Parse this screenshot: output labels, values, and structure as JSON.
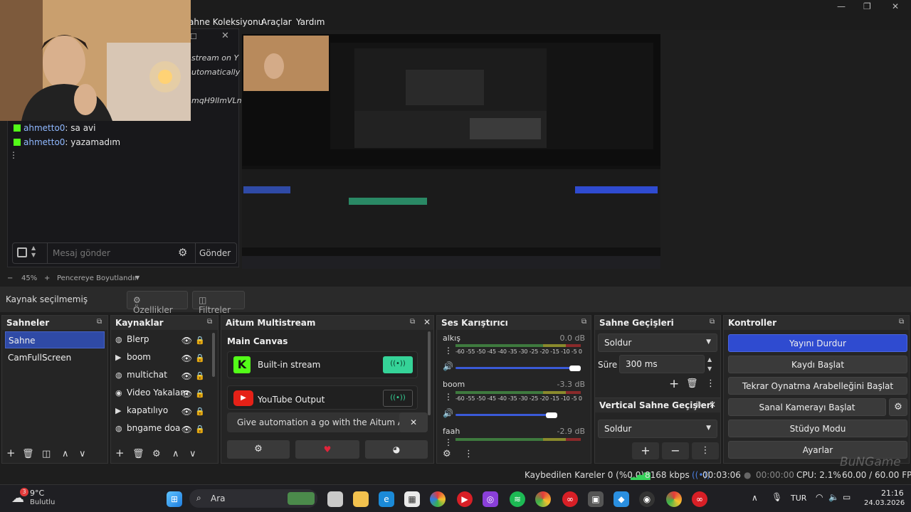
{
  "menu": {
    "items": [
      "ahne Koleksiyonu",
      "Araçlar",
      "Yardım"
    ]
  },
  "chat": {
    "ghost_lines": [
      "stream on Y",
      "utomatically",
      "mqH9lImVLn"
    ],
    "messages": [
      {
        "user": "ahmetto0",
        "text": ": sa avi"
      },
      {
        "user": "ahmetto0",
        "text": ": yazamadım"
      }
    ],
    "input_placeholder": "Mesaj gönder",
    "send_label": "Gönder"
  },
  "zoom": {
    "minus": "−",
    "value": "45%",
    "plus": "+",
    "fit_label": "Pencereye Boyutlandır"
  },
  "propbar": {
    "no_source": "Kaynak seçilmemiş",
    "properties": "Özellikler",
    "filters": "Filtreler"
  },
  "scenes": {
    "title": "Sahneler",
    "items": [
      "Sahne",
      "CamFullScreen"
    ]
  },
  "sources": {
    "title": "Kaynaklar",
    "items": [
      {
        "icon": "globe-icon",
        "label": "Blerp"
      },
      {
        "icon": "play-icon",
        "label": "boom"
      },
      {
        "icon": "globe-icon",
        "label": "multichat"
      },
      {
        "icon": "camera-icon",
        "label": "Video Yakalam"
      },
      {
        "icon": "play-icon",
        "label": "kapatılıyo"
      },
      {
        "icon": "globe-icon",
        "label": "bngame doa"
      }
    ]
  },
  "multistream": {
    "title": "Aitum Multistream",
    "canvas": "Main Canvas",
    "outputs": [
      {
        "label": "Built-in stream",
        "active": true
      },
      {
        "label": "YouTube Output",
        "active": false
      }
    ],
    "promo": "Give automation a go with the Aitum App"
  },
  "mixer": {
    "title": "Ses Karıştırıcı",
    "scale": "-60 -55 -50 -45 -40 -35 -30 -25 -20 -15 -10 -5 0",
    "channels": [
      {
        "name": "alkış",
        "db": "0.0 dB",
        "level": 1.0
      },
      {
        "name": "boom",
        "db": "-3.3 dB",
        "level": 0.81
      },
      {
        "name": "faah",
        "db": "-2.9 dB",
        "level": 0.85
      }
    ]
  },
  "transitions": {
    "title": "Sahne Geçişleri",
    "selected": "Soldur",
    "duration_label": "Süre",
    "duration": "300 ms",
    "vertical_title": "Vertical Sahne Geçişleri",
    "vertical_selected": "Soldur"
  },
  "controls": {
    "title": "Kontroller",
    "stop_stream": "Yayını Durdur",
    "start_recording": "Kaydı Başlat",
    "replay_buffer": "Tekrar Oynatma Arabelleğini Başlat",
    "virtual_cam": "Sanal Kamerayı Başlat",
    "studio_mode": "Stüdyo Modu",
    "settings": "Ayarlar"
  },
  "status": {
    "dropped": "Kaybedilen Kareler 0 (%0.0)",
    "bitrate": "8168 kbps",
    "stream_time": "00:03:06",
    "rec_time": "00:00:00",
    "cpu": "CPU: 2.1%",
    "fps": "60.00 / 60.00 FPS"
  },
  "watermark": "BuNGame",
  "taskbar": {
    "weather_badge": "3",
    "temp": "9°C",
    "weather": "Bulutlu",
    "search": "Ara",
    "lang": "TUR",
    "time": "21:16",
    "date": "24.03.2026"
  },
  "colors": {
    "accent": "#2f4bd0",
    "selected": "#2f4aa6",
    "live": "#35d398",
    "kick": "#53fc18"
  }
}
